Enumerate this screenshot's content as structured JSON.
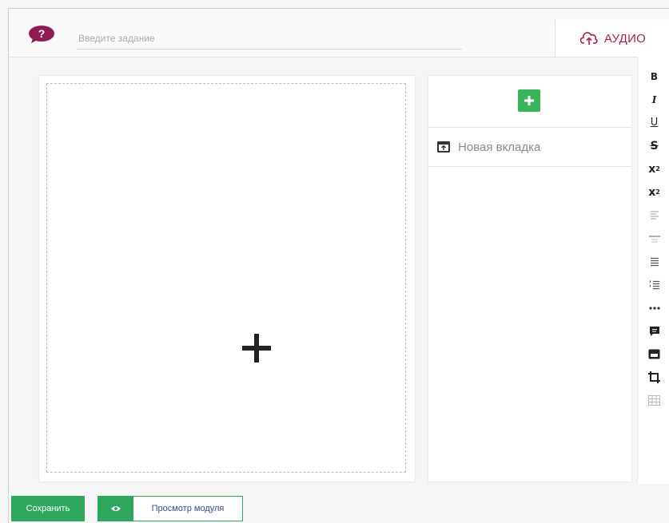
{
  "header": {
    "task_placeholder": "Введите задание",
    "task_value": "",
    "audio_label": "АУДИО"
  },
  "canvas": {
    "add_icon": "plus-icon"
  },
  "tabs": {
    "add_icon": "plus-icon",
    "items": [
      {
        "label": "Новая вкладка",
        "icon": "tab-icon"
      }
    ]
  },
  "toolbar": {
    "bold": "B",
    "italic": "I",
    "underline": "U",
    "strikethrough": "S",
    "superscript_base": "x",
    "superscript_exp": "2",
    "subscript_base": "x",
    "subscript_exp": "2",
    "icons": [
      "align-icon",
      "horizontal-rule-icon",
      "bullet-list-icon",
      "numbered-list-icon",
      "more-icon",
      "comment-icon",
      "image-icon",
      "crop-icon",
      "table-icon"
    ]
  },
  "footer": {
    "save_label": "Сохранить",
    "preview_label": "Просмотр модуля"
  },
  "colors": {
    "brand": "#a31f5a",
    "primary": "#2fa75c",
    "add_button": "#3bb35a"
  }
}
